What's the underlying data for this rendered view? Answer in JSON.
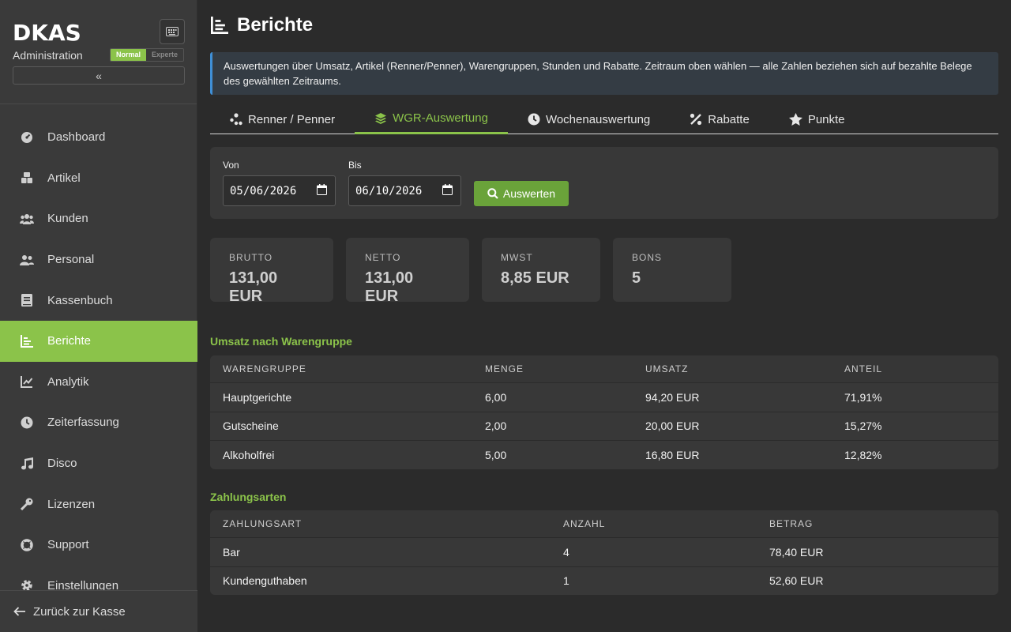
{
  "sidebar": {
    "logo": "DKAS",
    "subtitle": "Administration",
    "mode_normal": "Normal",
    "mode_expert": "Experte",
    "collapse_glyph": "«",
    "items": [
      {
        "label": "Dashboard",
        "icon": "gauge-icon"
      },
      {
        "label": "Artikel",
        "icon": "boxes-icon"
      },
      {
        "label": "Kunden",
        "icon": "users-icon"
      },
      {
        "label": "Personal",
        "icon": "user-group-icon"
      },
      {
        "label": "Kassenbuch",
        "icon": "book-icon"
      },
      {
        "label": "Berichte",
        "icon": "bar-chart-icon"
      },
      {
        "label": "Analytik",
        "icon": "line-chart-icon"
      },
      {
        "label": "Zeiterfassung",
        "icon": "clock-icon"
      },
      {
        "label": "Disco",
        "icon": "music-icon"
      },
      {
        "label": "Lizenzen",
        "icon": "key-icon"
      },
      {
        "label": "Support",
        "icon": "lifebuoy-icon"
      },
      {
        "label": "Einstellungen",
        "icon": "gear-icon"
      }
    ],
    "active_item": "Berichte",
    "back_label": "Zurück zur Kasse"
  },
  "page": {
    "title": "Berichte",
    "info": "Auswertungen über Umsatz, Artikel (Renner/Penner), Warengruppen, Stunden und Rabatte. Zeitraum oben wählen — alle Zahlen beziehen sich auf bezahlte Belege des gewählten Zeitraums."
  },
  "tabs": [
    {
      "label": "Renner / Penner",
      "icon": "ranking-icon",
      "active": false
    },
    {
      "label": "WGR-Auswertung",
      "icon": "layers-icon",
      "active": true
    },
    {
      "label": "Wochenauswertung",
      "icon": "clock-icon",
      "active": false
    },
    {
      "label": "Rabatte",
      "icon": "percent-icon",
      "active": false
    },
    {
      "label": "Punkte",
      "icon": "star-icon",
      "active": false
    }
  ],
  "filter": {
    "from_label": "Von",
    "from_value": "05/06/2026",
    "to_label": "Bis",
    "to_value": "06/10/2026",
    "run_label": "Auswerten"
  },
  "kpis": [
    {
      "label": "BRUTTO",
      "value": "131,00 EUR"
    },
    {
      "label": "NETTO",
      "value": "131,00 EUR"
    },
    {
      "label": "MWST",
      "value": "8,85 EUR"
    },
    {
      "label": "BONS",
      "value": "5"
    }
  ],
  "wgr": {
    "title": "Umsatz nach Warengruppe",
    "headers": [
      "WARENGRUPPE",
      "MENGE",
      "UMSATZ",
      "ANTEIL"
    ],
    "rows": [
      [
        "Hauptgerichte",
        "6,00",
        "94,20 EUR",
        "71,91%"
      ],
      [
        "Gutscheine",
        "2,00",
        "20,00 EUR",
        "15,27%"
      ],
      [
        "Alkoholfrei",
        "5,00",
        "16,80 EUR",
        "12,82%"
      ]
    ]
  },
  "payments": {
    "title": "Zahlungsarten",
    "headers": [
      "ZAHLUNGSART",
      "ANZAHL",
      "BETRAG"
    ],
    "rows": [
      [
        "Bar",
        "4",
        "78,40 EUR"
      ],
      [
        "Kundenguthaben",
        "1",
        "52,60 EUR"
      ]
    ]
  },
  "colors": {
    "accent": "#8bc34a",
    "info_border": "#3f8fd6"
  }
}
